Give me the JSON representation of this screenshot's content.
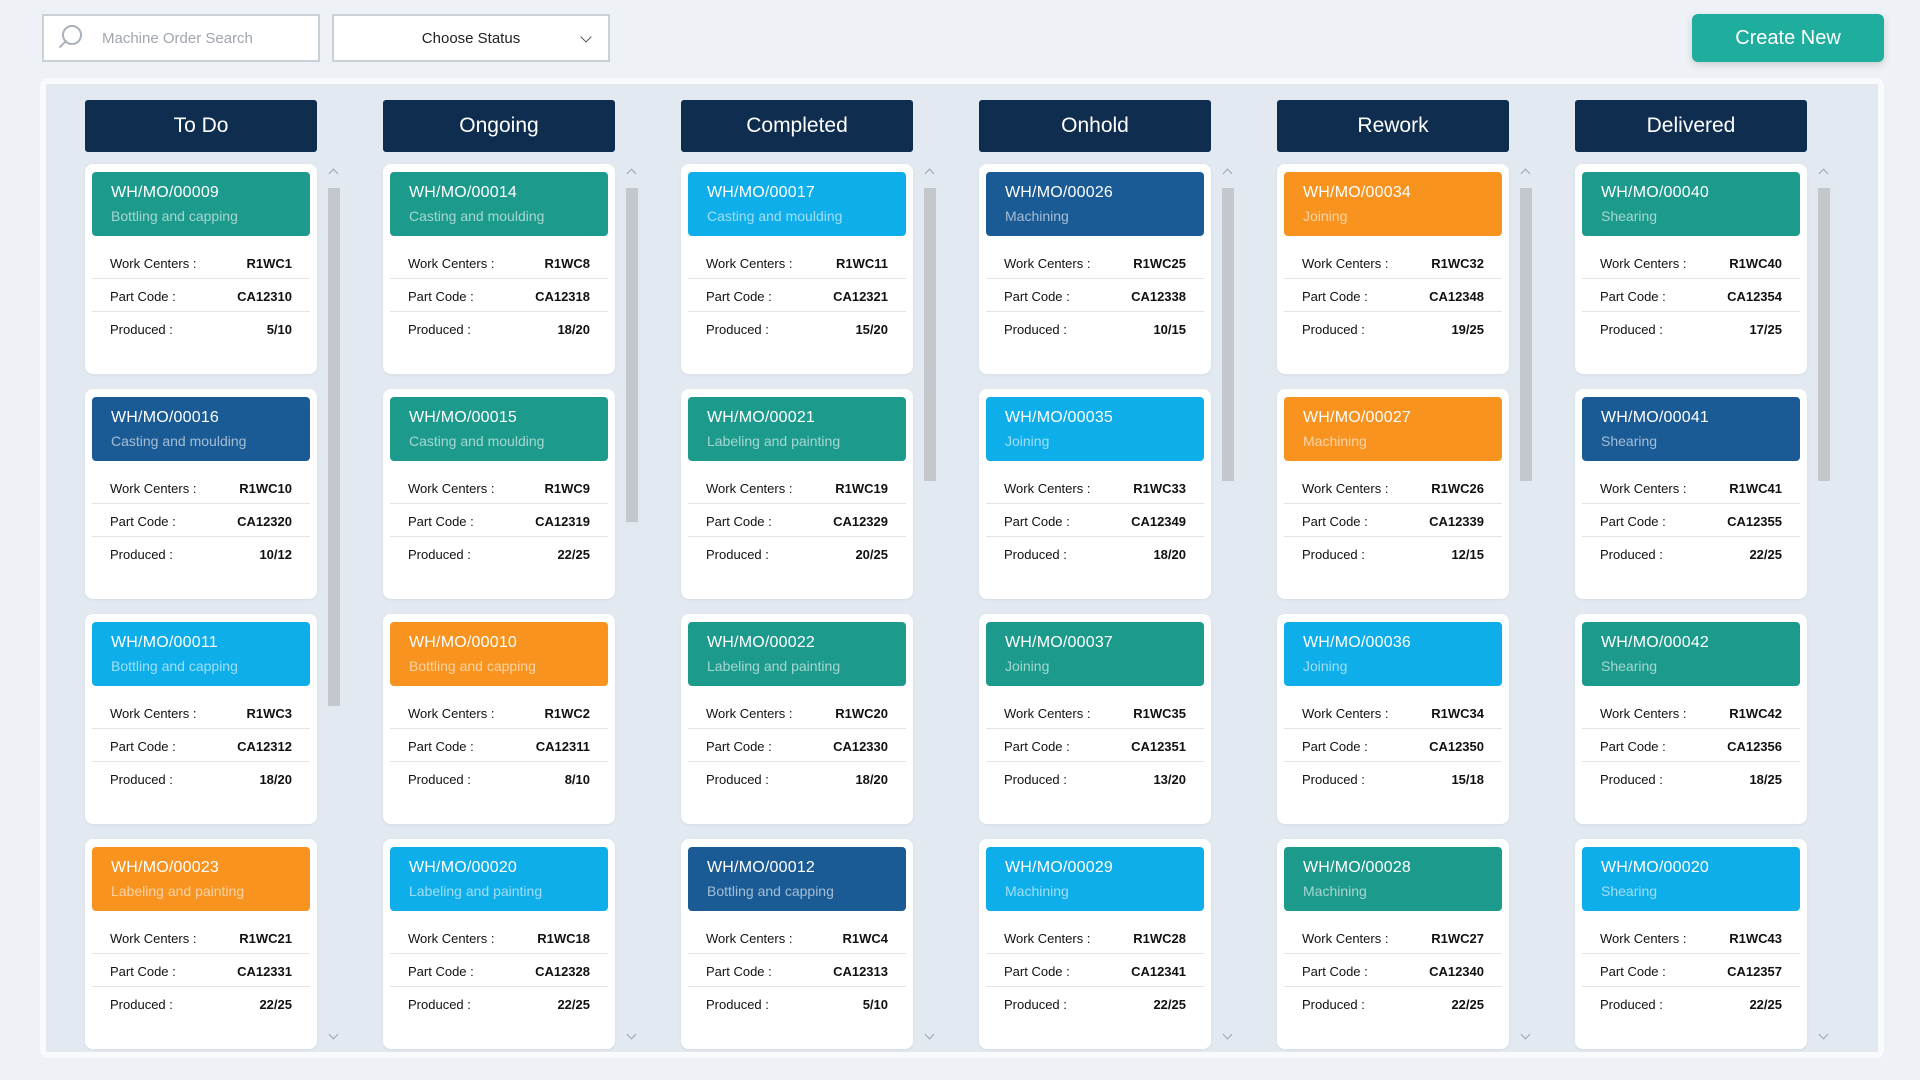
{
  "search": {
    "placeholder": "Machine Order Search"
  },
  "status_filter": {
    "label": "Choose Status"
  },
  "create_button": {
    "label": "Create New"
  },
  "labels": {
    "work_centers": "Work Centers :",
    "part_code": "Part Code :",
    "produced": "Produced :"
  },
  "colors": {
    "teal": "#1c9a8c",
    "blue": "#1a5a95",
    "sky": "#0eaeea",
    "orange": "#f7931e",
    "header": "#0f2d4f",
    "create": "#1fae9d"
  },
  "columns": [
    {
      "title": "To Do",
      "scroll": {
        "position": 0.0,
        "visible": 0.62
      },
      "cards": [
        {
          "id": "WH/MO/00009",
          "process": "Bottling and capping",
          "color": "teal",
          "work_center": "R1WC1",
          "part_code": "CA12310",
          "produced": "5/10"
        },
        {
          "id": "WH/MO/00016",
          "process": "Casting and moulding",
          "color": "blue",
          "work_center": "R1WC10",
          "part_code": "CA12320",
          "produced": "10/12"
        },
        {
          "id": "WH/MO/00011",
          "process": "Bottling and capping",
          "color": "sky",
          "work_center": "R1WC3",
          "part_code": "CA12312",
          "produced": "18/20"
        },
        {
          "id": "WH/MO/00023",
          "process": "Labeling and painting",
          "color": "orange",
          "work_center": "R1WC21",
          "part_code": "CA12331",
          "produced": "22/25"
        }
      ]
    },
    {
      "title": "Ongoing",
      "scroll": {
        "position": 0.0,
        "visible": 0.4
      },
      "cards": [
        {
          "id": "WH/MO/00014",
          "process": "Casting and moulding",
          "color": "teal",
          "work_center": "R1WC8",
          "part_code": "CA12318",
          "produced": "18/20"
        },
        {
          "id": "WH/MO/00015",
          "process": "Casting and moulding",
          "color": "teal",
          "work_center": "R1WC9",
          "part_code": "CA12319",
          "produced": "22/25"
        },
        {
          "id": "WH/MO/00010",
          "process": "Bottling and capping",
          "color": "orange",
          "work_center": "R1WC2",
          "part_code": "CA12311",
          "produced": "8/10"
        },
        {
          "id": "WH/MO/00020",
          "process": "Labeling and painting",
          "color": "sky",
          "work_center": "R1WC18",
          "part_code": "CA12328",
          "produced": "22/25"
        }
      ]
    },
    {
      "title": "Completed",
      "scroll": {
        "position": 0.0,
        "visible": 0.35
      },
      "cards": [
        {
          "id": "WH/MO/00017",
          "process": "Casting and moulding",
          "color": "sky",
          "work_center": "R1WC11",
          "part_code": "CA12321",
          "produced": "15/20"
        },
        {
          "id": "WH/MO/00021",
          "process": "Labeling and painting",
          "color": "teal",
          "work_center": "R1WC19",
          "part_code": "CA12329",
          "produced": "20/25"
        },
        {
          "id": "WH/MO/00022",
          "process": "Labeling and painting",
          "color": "teal",
          "work_center": "R1WC20",
          "part_code": "CA12330",
          "produced": "18/20"
        },
        {
          "id": "WH/MO/00012",
          "process": "Bottling and capping",
          "color": "blue",
          "work_center": "R1WC4",
          "part_code": "CA12313",
          "produced": "5/10"
        }
      ]
    },
    {
      "title": "Onhold",
      "scroll": {
        "position": 0.0,
        "visible": 0.35
      },
      "cards": [
        {
          "id": "WH/MO/00026",
          "process": "Machining",
          "color": "blue",
          "work_center": "R1WC25",
          "part_code": "CA12338",
          "produced": "10/15"
        },
        {
          "id": "WH/MO/00035",
          "process": "Joining",
          "color": "sky",
          "work_center": "R1WC33",
          "part_code": "CA12349",
          "produced": "18/20"
        },
        {
          "id": "WH/MO/00037",
          "process": "Joining",
          "color": "teal",
          "work_center": "R1WC35",
          "part_code": "CA12351",
          "produced": "13/20"
        },
        {
          "id": "WH/MO/00029",
          "process": "Machining",
          "color": "sky",
          "work_center": "R1WC28",
          "part_code": "CA12341",
          "produced": "22/25"
        }
      ]
    },
    {
      "title": "Rework",
      "scroll": {
        "position": 0.0,
        "visible": 0.35
      },
      "cards": [
        {
          "id": "WH/MO/00034",
          "process": "Joining",
          "color": "orange",
          "work_center": "R1WC32",
          "part_code": "CA12348",
          "produced": "19/25"
        },
        {
          "id": "WH/MO/00027",
          "process": "Machining",
          "color": "orange",
          "work_center": "R1WC26",
          "part_code": "CA12339",
          "produced": "12/15"
        },
        {
          "id": "WH/MO/00036",
          "process": "Joining",
          "color": "sky",
          "work_center": "R1WC34",
          "part_code": "CA12350",
          "produced": "15/18"
        },
        {
          "id": "WH/MO/00028",
          "process": "Machining",
          "color": "teal",
          "work_center": "R1WC27",
          "part_code": "CA12340",
          "produced": "22/25"
        }
      ]
    },
    {
      "title": "Delivered",
      "scroll": {
        "position": 0.0,
        "visible": 0.35
      },
      "cards": [
        {
          "id": "WH/MO/00040",
          "process": "Shearing",
          "color": "teal",
          "work_center": "R1WC40",
          "part_code": "CA12354",
          "produced": "17/25"
        },
        {
          "id": "WH/MO/00041",
          "process": "Shearing",
          "color": "blue",
          "work_center": "R1WC41",
          "part_code": "CA12355",
          "produced": "22/25"
        },
        {
          "id": "WH/MO/00042",
          "process": "Shearing",
          "color": "teal",
          "work_center": "R1WC42",
          "part_code": "CA12356",
          "produced": "18/25"
        },
        {
          "id": "WH/MO/00020",
          "process": "Shearing",
          "color": "sky",
          "work_center": "R1WC43",
          "part_code": "CA12357",
          "produced": "22/25"
        }
      ]
    }
  ]
}
